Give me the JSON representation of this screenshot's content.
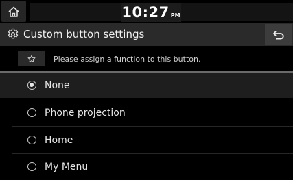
{
  "status": {
    "home_icon": "home-icon",
    "time": "10:27",
    "ampm": "PM"
  },
  "header": {
    "icon": "gear-icon",
    "title": "Custom button settings",
    "back_icon": "back-arrow-icon"
  },
  "hint": {
    "icon": "star-icon",
    "text": "Please assign a function to this button."
  },
  "options": [
    {
      "label": "None",
      "selected": true
    },
    {
      "label": "Phone projection",
      "selected": false
    },
    {
      "label": "Home",
      "selected": false
    },
    {
      "label": "My Menu",
      "selected": false
    }
  ],
  "colors": {
    "background": "#000000",
    "title_bar": "#2a2a2a",
    "back_button": "#3c3c3c",
    "selected_row": "#1e1e1e"
  }
}
